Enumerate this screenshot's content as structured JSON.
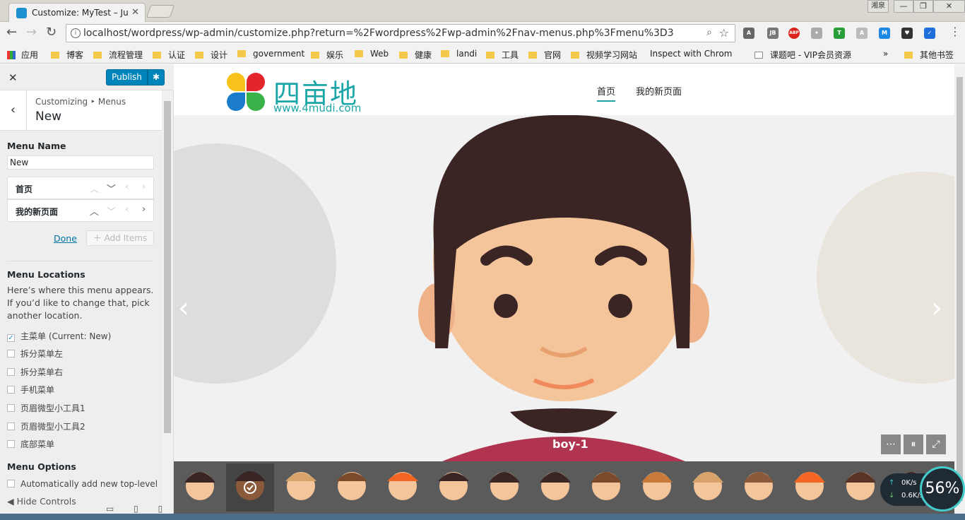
{
  "browser": {
    "tab_title": "Customize: MyTest – Ju",
    "url": "localhost/wordpress/wp-admin/customize.php?return=%2Fwordpress%2Fwp-admin%2Fnav-menus.php%3Fmenu%3D3",
    "window_label": "湘泉",
    "bookmarks": [
      "应用",
      "博客",
      "流程管理",
      "认证",
      "设计",
      "government",
      "娱乐",
      "Web",
      "健康",
      "landi",
      "工具",
      "官网",
      "视频学习网站",
      "Inspect with Chrom",
      "课题吧 - VIP会员资源",
      "其他书签"
    ]
  },
  "customizer": {
    "publish_label": "Publish",
    "breadcrumb": "Customizing ‣ Menus",
    "section_title": "New",
    "menu_name_label": "Menu Name",
    "menu_name_value": "New",
    "items": [
      "首页",
      "我的新页面"
    ],
    "done_label": "Done",
    "add_items_label": "Add Items",
    "locations_label": "Menu Locations",
    "locations_desc": "Here’s where this menu appears. If you’d like to change that, pick another location.",
    "locations": [
      {
        "label": "主菜单 (Current: New)",
        "checked": true
      },
      {
        "label": "拆分菜单左",
        "checked": false
      },
      {
        "label": "拆分菜单右",
        "checked": false
      },
      {
        "label": "手机菜单",
        "checked": false
      },
      {
        "label": "页眉微型小工具1",
        "checked": false
      },
      {
        "label": "页眉微型小工具2",
        "checked": false
      },
      {
        "label": "底部菜单",
        "checked": false
      }
    ],
    "options_label": "Menu Options",
    "auto_add_label": "Automatically add new top-level",
    "hide_controls": "Hide Controls"
  },
  "site": {
    "logo_text": "四亩地",
    "logo_url": "www.4mudi.com",
    "nav": [
      "首页",
      "我的新页面"
    ],
    "slide_caption": "boy-1"
  },
  "widget": {
    "up_speed": "0K/s",
    "down_speed": "0.6K/s",
    "percent": "56%"
  }
}
